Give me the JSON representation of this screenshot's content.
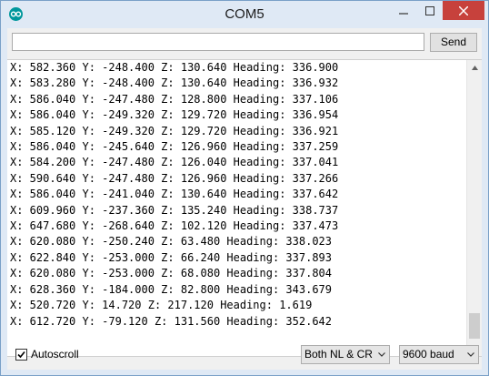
{
  "window": {
    "title": "COM5"
  },
  "serial_input": {
    "value": "",
    "placeholder": ""
  },
  "send_button": {
    "label": "Send"
  },
  "output_lines": [
    "X: 582.360 Y: -248.400 Z: 130.640 Heading: 336.900",
    "X: 583.280 Y: -248.400 Z: 130.640 Heading: 336.932",
    "X: 586.040 Y: -247.480 Z: 128.800 Heading: 337.106",
    "X: 586.040 Y: -249.320 Z: 129.720 Heading: 336.954",
    "X: 585.120 Y: -249.320 Z: 129.720 Heading: 336.921",
    "X: 586.040 Y: -245.640 Z: 126.960 Heading: 337.259",
    "X: 584.200 Y: -247.480 Z: 126.040 Heading: 337.041",
    "X: 590.640 Y: -247.480 Z: 126.960 Heading: 337.266",
    "X: 586.040 Y: -241.040 Z: 130.640 Heading: 337.642",
    "X: 609.960 Y: -237.360 Z: 135.240 Heading: 338.737",
    "X: 647.680 Y: -268.640 Z: 102.120 Heading: 337.473",
    "X: 620.080 Y: -250.240 Z: 63.480 Heading: 338.023",
    "X: 622.840 Y: -253.000 Z: 66.240 Heading: 337.893",
    "X: 620.080 Y: -253.000 Z: 68.080 Heading: 337.804",
    "X: 628.360 Y: -184.000 Z: 82.800 Heading: 343.679",
    "X: 520.720 Y: 14.720 Z: 217.120 Heading: 1.619",
    "X: 612.720 Y: -79.120 Z: 131.560 Heading: 352.642"
  ],
  "autoscroll": {
    "label": "Autoscroll",
    "checked": true
  },
  "line_ending_select": {
    "value": "Both NL & CR"
  },
  "baud_select": {
    "value": "9600 baud"
  },
  "colors": {
    "close_button": "#c7413c",
    "arduino_icon": "#00979c"
  }
}
